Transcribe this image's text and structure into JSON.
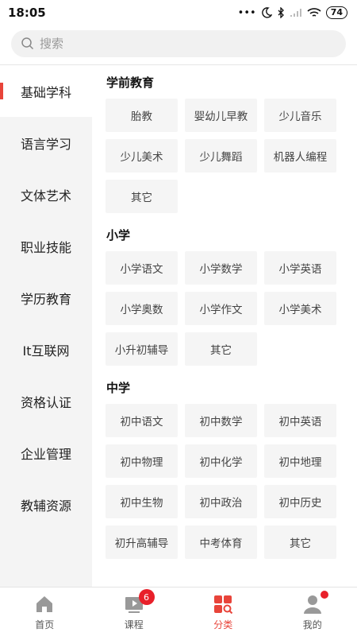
{
  "status_bar": {
    "time": "18:05",
    "battery": "74",
    "dots": "•••"
  },
  "search": {
    "placeholder": "搜索"
  },
  "sidebar": {
    "items": [
      {
        "label": "基础学科"
      },
      {
        "label": "语言学习"
      },
      {
        "label": "文体艺术"
      },
      {
        "label": "职业技能"
      },
      {
        "label": "学历教育"
      },
      {
        "label": "It互联网"
      },
      {
        "label": "资格认证"
      },
      {
        "label": "企业管理"
      },
      {
        "label": "教辅资源"
      }
    ]
  },
  "sections": [
    {
      "title": "学前教育",
      "tags": [
        "胎教",
        "婴幼儿早教",
        "少儿音乐",
        "少儿美术",
        "少儿舞蹈",
        "机器人编程",
        "其它"
      ]
    },
    {
      "title": "小学",
      "tags": [
        "小学语文",
        "小学数学",
        "小学英语",
        "小学奥数",
        "小学作文",
        "小学美术",
        "小升初辅导",
        "其它"
      ]
    },
    {
      "title": "中学",
      "tags": [
        "初中语文",
        "初中数学",
        "初中英语",
        "初中物理",
        "初中化学",
        "初中地理",
        "初中生物",
        "初中政治",
        "初中历史",
        "初升高辅导",
        "中考体育",
        "其它"
      ]
    }
  ],
  "tabbar": {
    "home": "首页",
    "courses": "课程",
    "courses_badge": "6",
    "category": "分类",
    "mine": "我的"
  },
  "colors": {
    "accent": "#e8443a",
    "badge": "#e8202a"
  }
}
